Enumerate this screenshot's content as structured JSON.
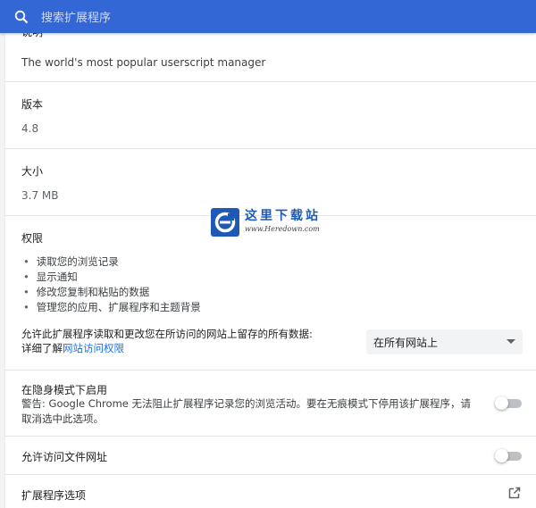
{
  "search": {
    "placeholder": "搜索扩展程序"
  },
  "description": {
    "label": "说明",
    "value": "The world's most popular userscript manager"
  },
  "version": {
    "label": "版本",
    "value": "4.8"
  },
  "size": {
    "label": "大小",
    "value": "3.7 MB"
  },
  "permissions": {
    "label": "权限",
    "items": [
      "读取您的浏览记录",
      "显示通知",
      "修改您复制和粘贴的数据",
      "管理您的应用、扩展程序和主题背景"
    ],
    "site_access_text": "允许此扩展程序读取和更改您在所访问的网站上留存的所有数据:",
    "learn_more_prefix": "详细了解",
    "learn_more_link": "网站访问权限",
    "site_access_selected": "在所有网站上"
  },
  "incognito": {
    "label": "在隐身模式下启用",
    "warning": "警告: Google Chrome 无法阻止扩展程序记录您的浏览活动。要在无痕模式下停用该扩展程序，请取消选中此选项。",
    "enabled": false
  },
  "file_urls": {
    "label": "允许访问文件网址",
    "enabled": false
  },
  "extension_options": {
    "label": "扩展程序选项"
  },
  "watermark": {
    "title": "这里下载站",
    "url": "www.Heredown.com"
  },
  "colors": {
    "topbar": "#3367d6",
    "link": "#1a73e8"
  }
}
